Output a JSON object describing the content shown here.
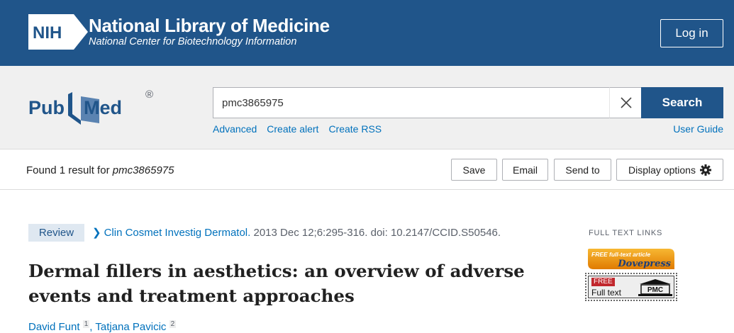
{
  "header": {
    "logo_text": "NIH",
    "title": "National Library of Medicine",
    "subtitle": "National Center for Biotechnology Information",
    "login_label": "Log in",
    "bg_color": "#20558a"
  },
  "search": {
    "brand": "PubMed",
    "query": "pmc3865975",
    "search_label": "Search",
    "links": [
      "Advanced",
      "Create alert",
      "Create RSS"
    ],
    "user_guide": "User Guide"
  },
  "results": {
    "found_prefix": "Found 1 result for ",
    "found_query": "pmc3865975",
    "actions": [
      "Save",
      "Email",
      "Send to",
      "Display options"
    ]
  },
  "article": {
    "type_badge": "Review",
    "journal": "Clin Cosmet Investig Dermatol.",
    "citation_rest": " 2013 Dec 12;6:295-316. doi: 10.2147/CCID.S50546.",
    "title": "Dermal fillers in aesthetics: an overview of adverse events and treatment approaches",
    "authors": [
      {
        "name": "David Funt",
        "aff": "1"
      },
      {
        "name": "Tatjana Pavicic",
        "aff": "2"
      }
    ]
  },
  "full_text_links": {
    "label": "FULL TEXT LINKS",
    "dove_top": "FREE full-text article",
    "dove_brand": "Dovepress",
    "pmc_free": "FREE",
    "pmc_fulltext": "Full text",
    "pmc_brand": "PMC"
  }
}
